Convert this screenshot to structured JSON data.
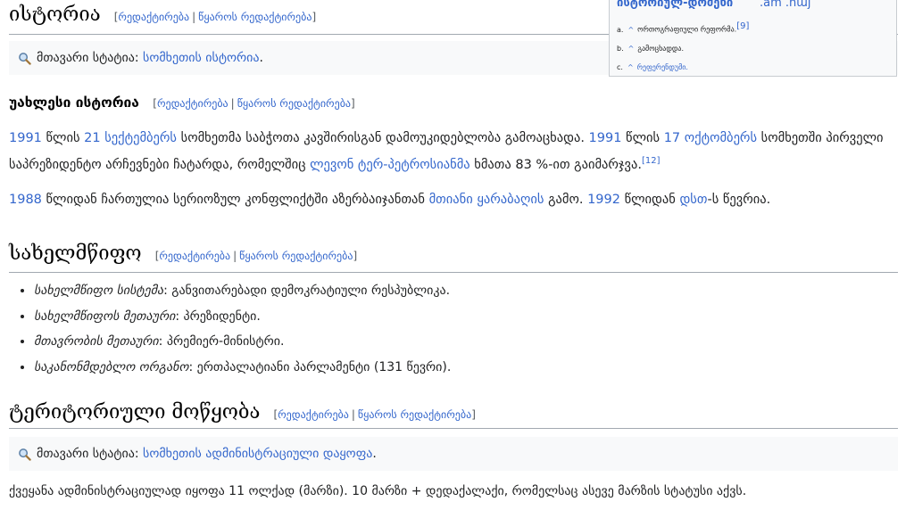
{
  "sections": {
    "history": {
      "title": "ისტორია"
    },
    "recent_history": {
      "title": "უახლესი ისტორია"
    },
    "government": {
      "title": "სახელმწიფო"
    },
    "territorial": {
      "title": "ტერიტორიული მოწყობა"
    }
  },
  "edit_links": {
    "open": "[",
    "edit": "რედაქტირება",
    "sep": "|",
    "edit_source": "წყაროს რედაქტირება",
    "close": "]"
  },
  "hatnotes": {
    "prefix": "მთავარი სტატია:",
    "history_link": "სომხეთის ისტორია",
    "admin_link": "სომხეთის ადმინისტრაციული დაყოფა",
    "end": "."
  },
  "recent_paragraph1": {
    "year1991a": "1991",
    "t1": " წლის ",
    "day21": "21",
    "sep_month": "სექტემბერს",
    "t2": " სომხეთმა საბჭოთა კავშირისგან დამოუკიდებლობა გამოაცხადა. ",
    "year1991b": "1991",
    "t3": " წლის ",
    "day17": "17",
    "oct_month": "ოქტომბერს",
    "t4": " სომხეთში პირველი საპრეზიდენტო არჩევნები ჩატარდა, რომელშიც ",
    "person": "ლევონ ტერ-პეტროსიანმა",
    "t5": " ხმათა 83 %-ით გაიმარჯვა.",
    "ref": "[12]"
  },
  "recent_paragraph2": {
    "year1988": "1988",
    "t1": " წლიდან ჩართულია სერიოზულ კონფლიქტში აზერბაიჯანთან ",
    "karabakh": "მთიანი ყარაბაღის",
    "t2": " გამო. ",
    "year1992": "1992",
    "t3": " წლიდან ",
    "dst": "დსთ",
    "t4": "-ს წევრია."
  },
  "government_list": [
    {
      "key": "სახელმწიფო სისტემა",
      "value": ": განვითარებადი დემოკრატიული რესპუბლიკა."
    },
    {
      "key": "სახელმწიფოს მეთაური",
      "value": ": პრეზიდენტი."
    },
    {
      "key": "მთავრობის მეთაური",
      "value": ": პრემიერ-მინისტრი."
    },
    {
      "key": "საკანონმდებლო ორგანო",
      "value": ": ერთპალატიანი პარლამენტი (131 წევრი)."
    }
  ],
  "territorial_text": "ქვეყანა ადმინისტრაციულად იყოფა 11 ოლქად (მარზი). 10 მარზი + დედაქალაქი, რომელსაც ასევე მარზის სტატუსი აქვს.",
  "refbox": {
    "head_left": "ისტორიულ-დომენი",
    "head_right": ".am .հայ",
    "items": [
      {
        "num": "a.",
        "caret": "^",
        "text": "ორთოგრაფიული რეფორმა.",
        "ref": "[9]"
      },
      {
        "num": "b.",
        "caret": "^",
        "text": "გამოცხადდა."
      },
      {
        "num": "c.",
        "caret": "^",
        "text": "რეფერენდუმი."
      }
    ]
  }
}
